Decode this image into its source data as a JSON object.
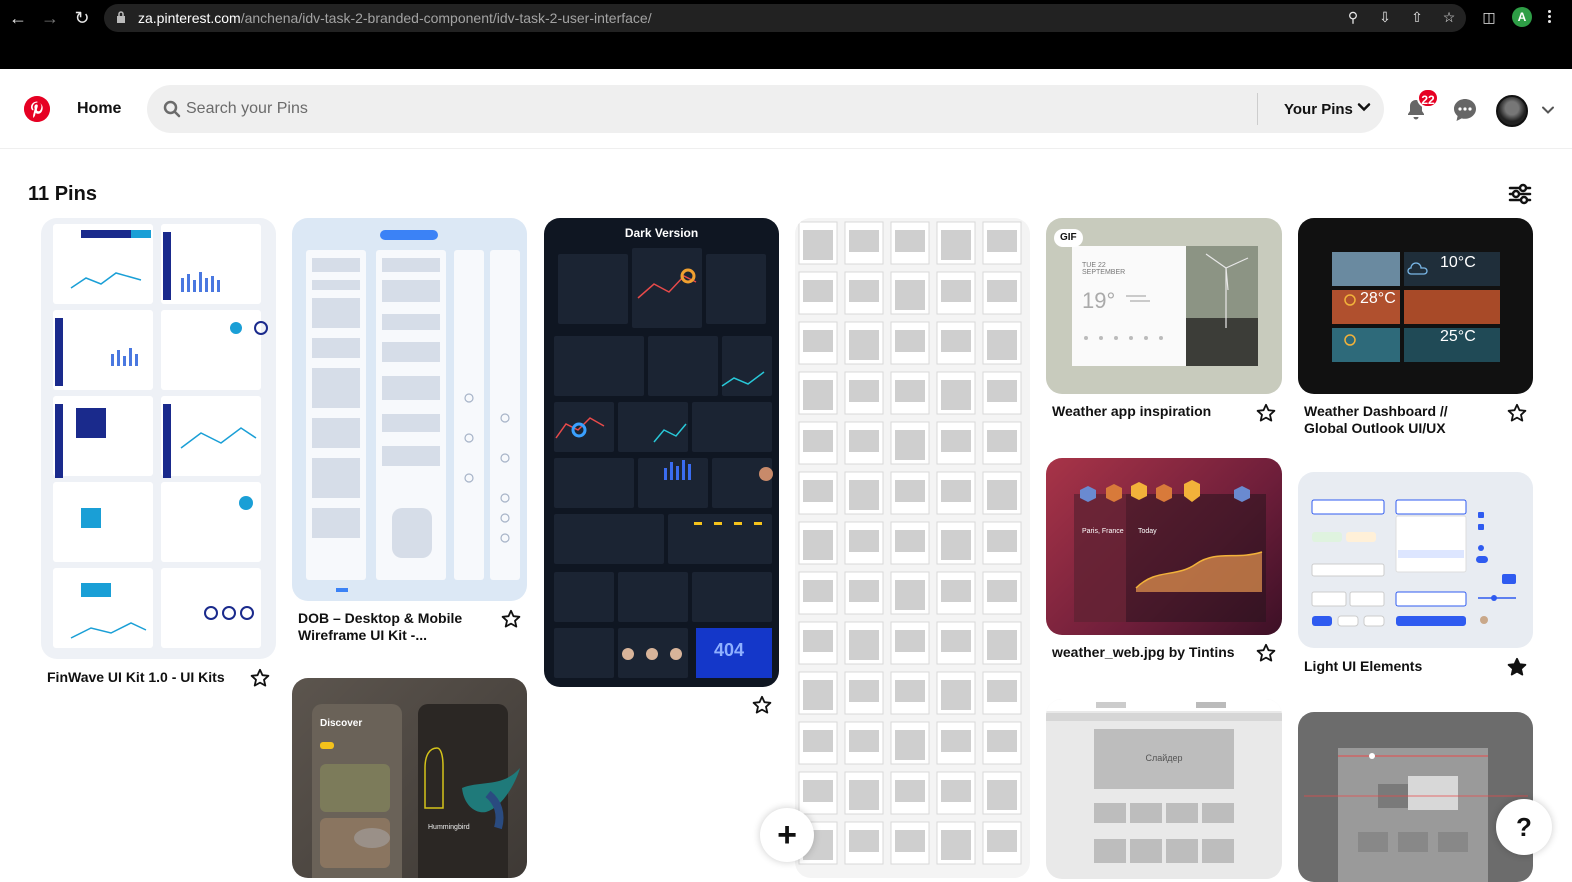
{
  "browser": {
    "url_host": "za.pinterest.com",
    "url_path": "/anchena/idv-task-2-branded-component/idv-task-2-user-interface/",
    "profile_initial": "A"
  },
  "header": {
    "home_label": "Home",
    "search_placeholder": "Search your Pins",
    "your_pins_label": "Your Pins",
    "notification_count": "22"
  },
  "board": {
    "pins_count": "11 Pins"
  },
  "pins": [
    {
      "title": "FinWave UI Kit 1.0 - UI Kits",
      "saved": false
    },
    {
      "title": "DOB – Desktop & Mobile Wireframe UI Kit -...",
      "saved": false
    },
    {
      "title": "",
      "overlay_text": "Dark Version",
      "saved": false
    },
    {
      "title": "",
      "saved": false
    },
    {
      "title": "Weather app inspiration",
      "badge": "GIF",
      "saved": false
    },
    {
      "title": "Weather Dashboard // Global Outlook UI/UX",
      "saved": false
    },
    {
      "title": "weather_web.jpg by Tintins",
      "saved": false
    },
    {
      "title": "Light UI Elements",
      "saved": true
    }
  ],
  "pin_texts": {
    "weather_date": "TUE 22 SEPTEMBER",
    "weather_temp": "19°",
    "dash_t1": "10°C",
    "dash_t2": "28°C",
    "dash_t3": "25°C",
    "discover": "Discover",
    "hummingbird": "Hummingbird",
    "slider_title": "Слайдер",
    "error_404": "404",
    "weather_web_city": "Paris, France",
    "weather_web_today": "Today"
  },
  "fab": {
    "add_label": "+",
    "help_label": "?"
  },
  "colors": {
    "brand": "#e60023",
    "text": "#111111",
    "search_bg": "#efefef"
  }
}
